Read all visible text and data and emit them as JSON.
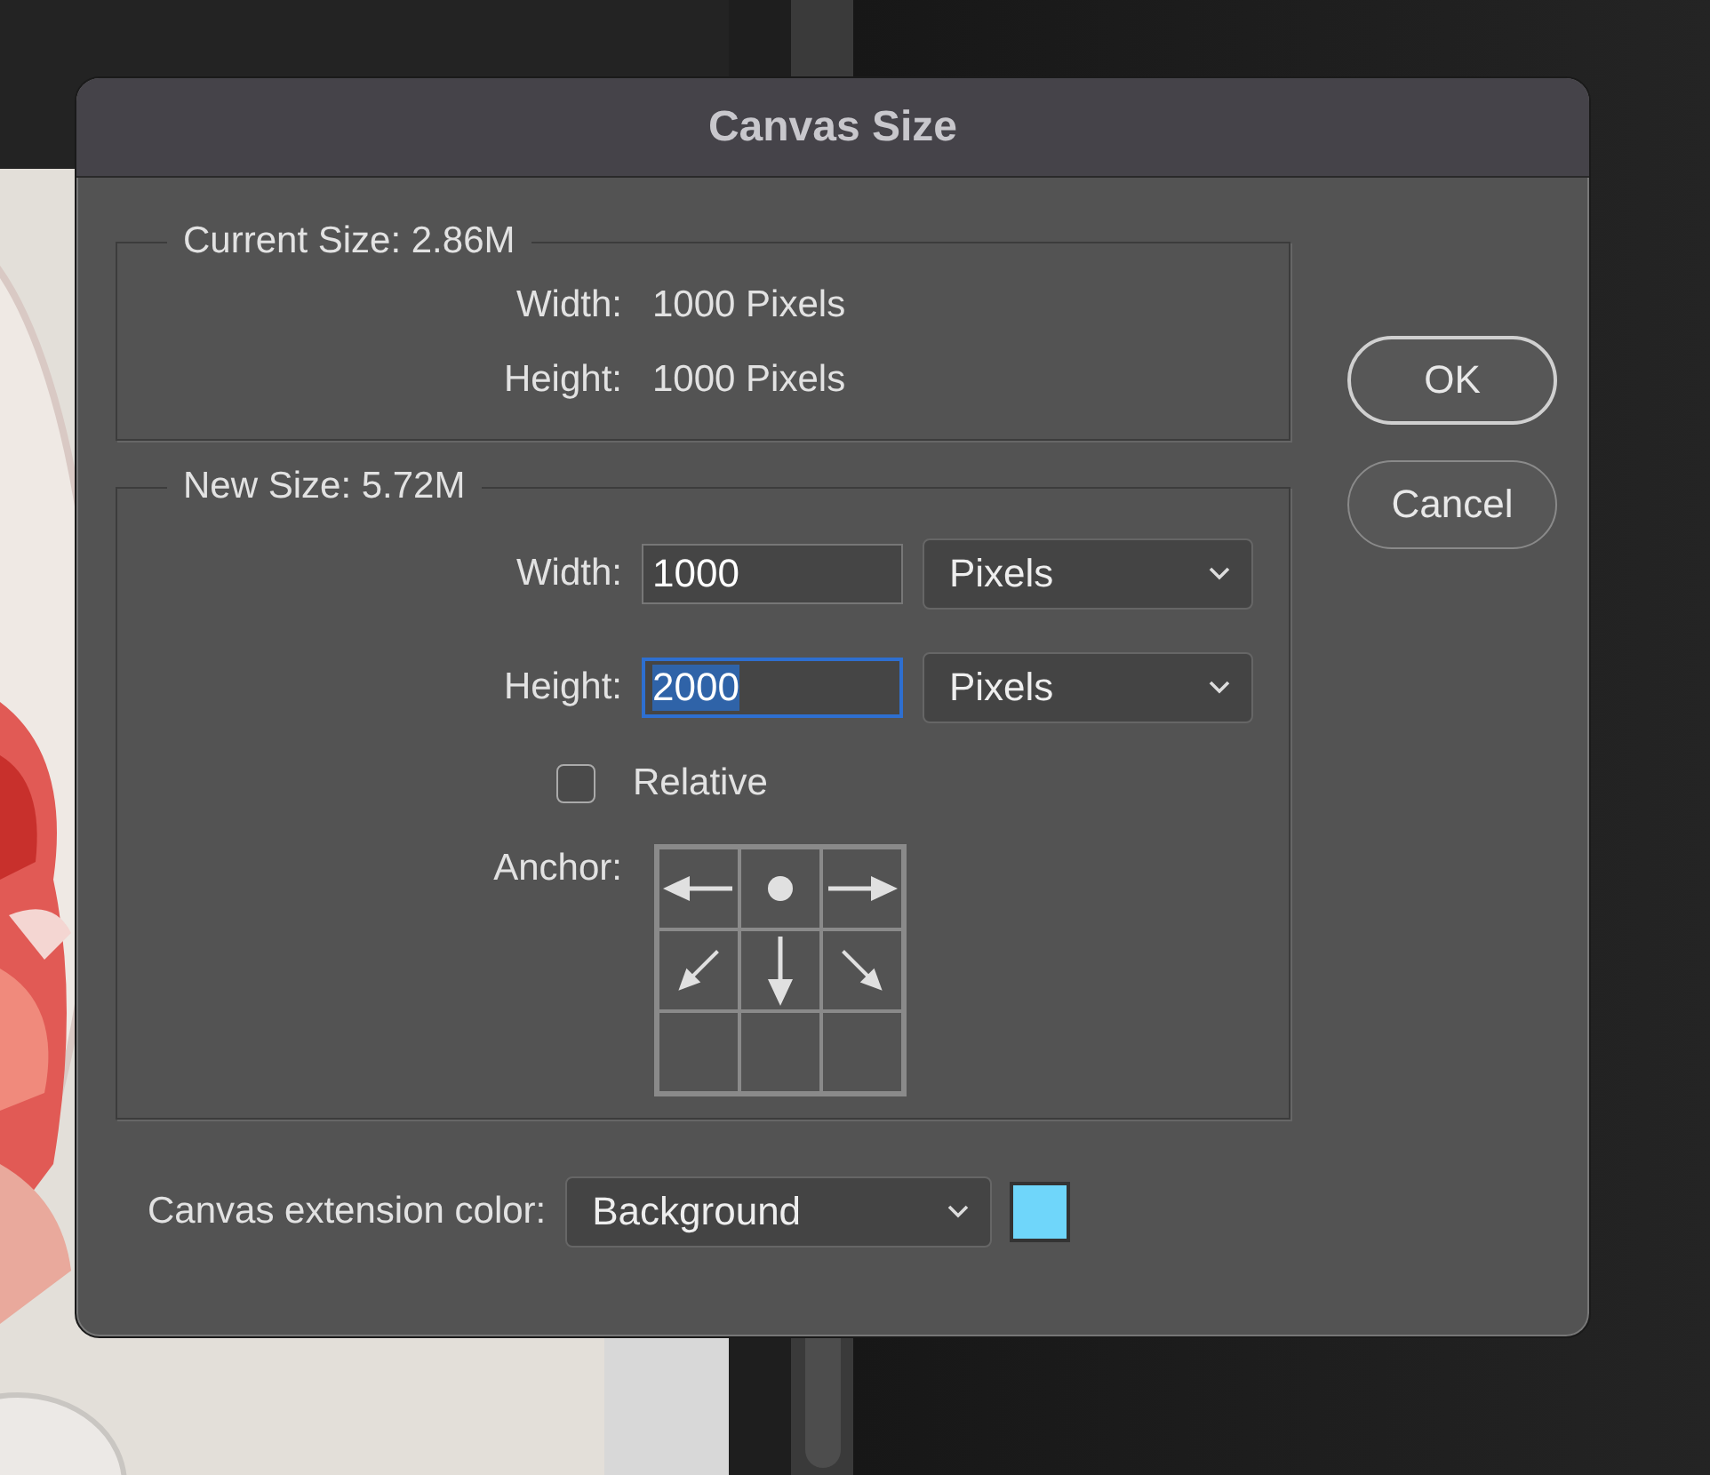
{
  "window": {
    "title": "Canvas Size"
  },
  "current_size": {
    "legend": "Current Size: 2.86M",
    "rows": [
      {
        "label": "Width:",
        "value": "1000 Pixels"
      },
      {
        "label": "Height:",
        "value": "1000 Pixels"
      }
    ]
  },
  "new_size": {
    "legend": "New Size: 5.72M",
    "fields": [
      {
        "label": "Width:",
        "value": "1000",
        "unit": "Pixels",
        "focused": false
      },
      {
        "label": "Height:",
        "value": "2000",
        "unit": "Pixels",
        "focused": true
      }
    ],
    "relative": {
      "label": "Relative",
      "checked": false
    },
    "anchor": {
      "label": "Anchor:",
      "cells": [
        {
          "kind": "left"
        },
        {
          "kind": "dot"
        },
        {
          "kind": "right"
        },
        {
          "kind": "down-left"
        },
        {
          "kind": "down"
        },
        {
          "kind": "down-right"
        },
        {
          "kind": "empty"
        },
        {
          "kind": "empty"
        },
        {
          "kind": "empty"
        }
      ]
    }
  },
  "buttons": [
    {
      "label": "OK",
      "default": true
    },
    {
      "label": "Cancel",
      "default": false
    }
  ],
  "extension_color": {
    "label": "Canvas extension color:",
    "value": "Background",
    "color": "#6fd6fa"
  }
}
